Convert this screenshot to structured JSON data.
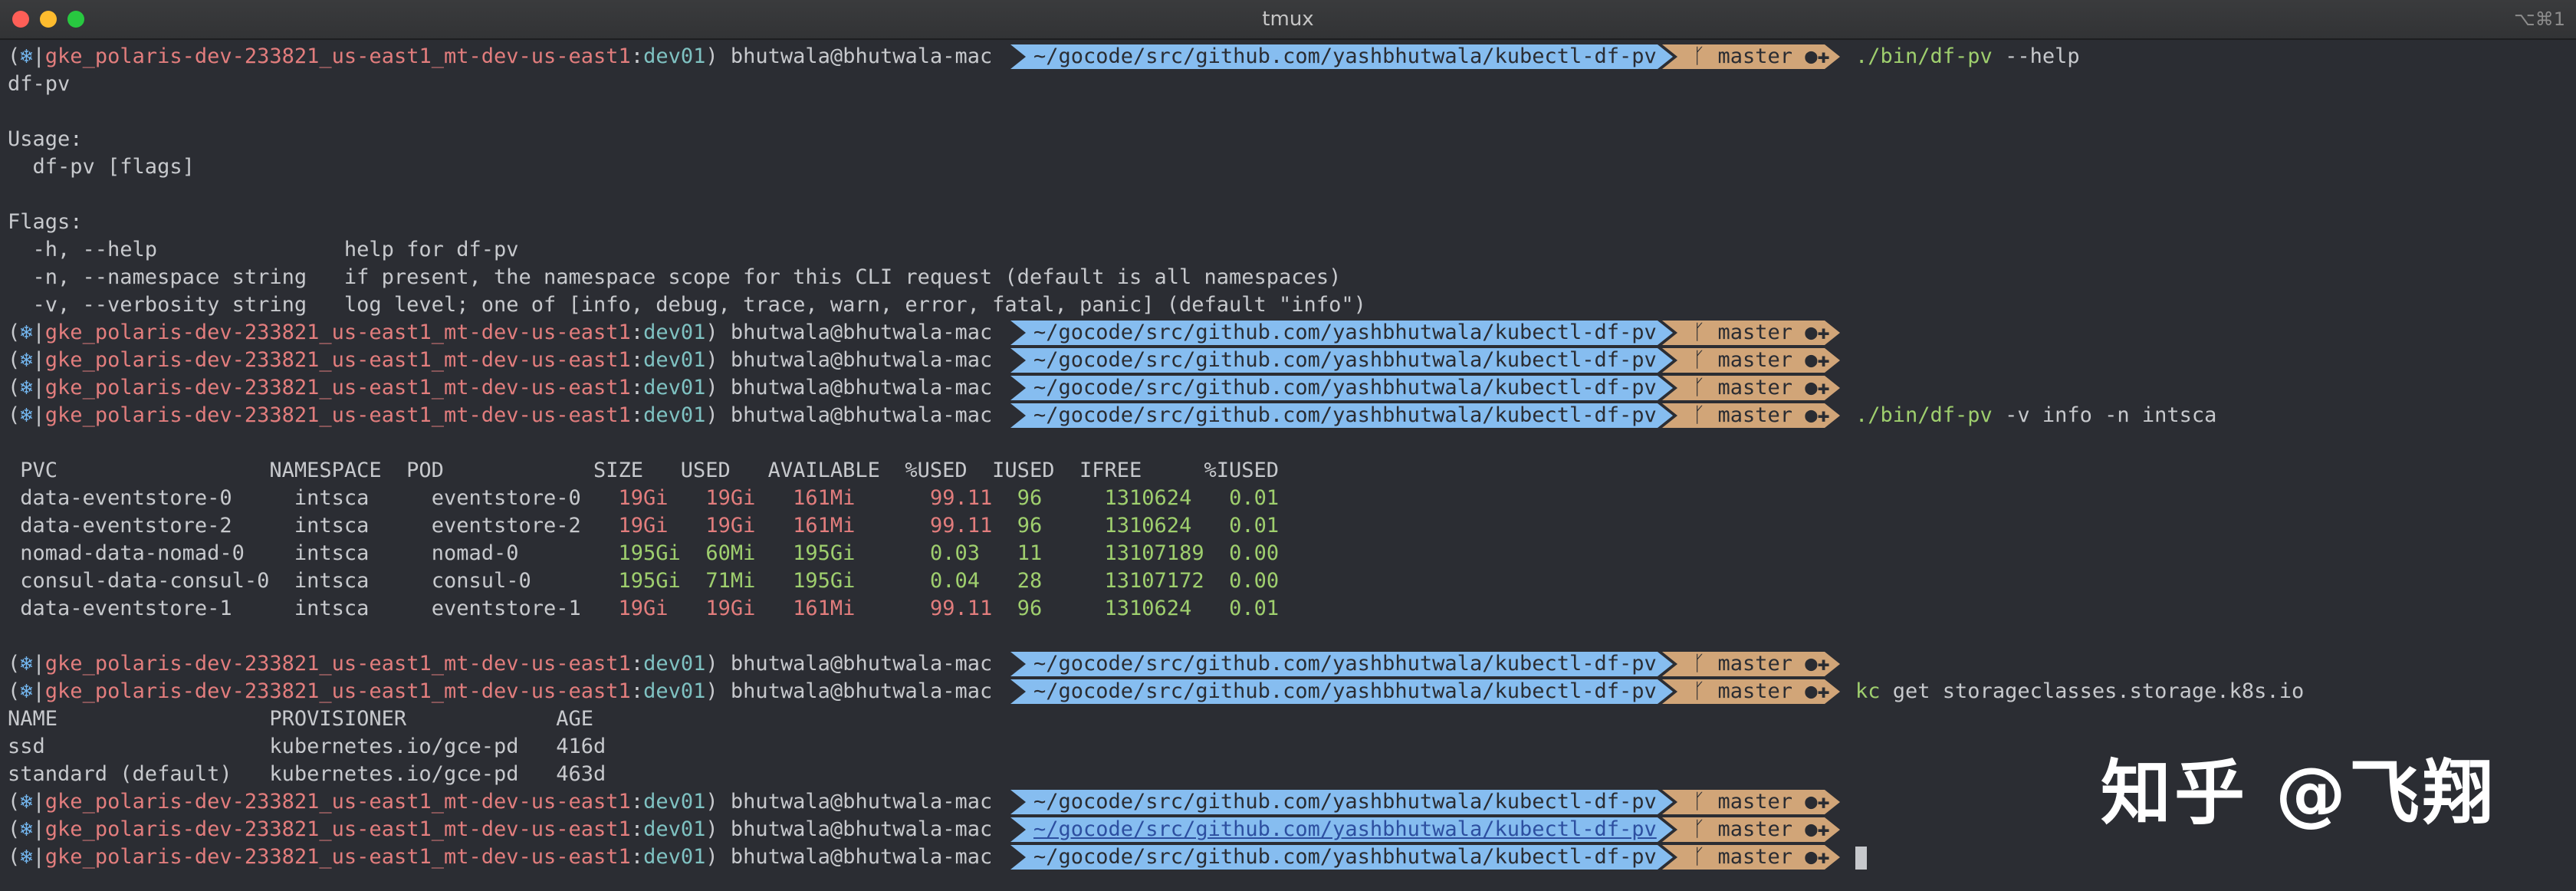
{
  "window": {
    "title": "tmux",
    "shortcut": "⌥⌘1"
  },
  "prompt": {
    "open": "(",
    "k8s_icon": "❄",
    "sep": "|",
    "context": "gke_polaris-dev-233821_us-east1_mt-dev-us-east1",
    "colon": ":",
    "namespace": "dev01",
    "close": ")",
    "user_host": "bhutwala@bhutwala-mac",
    "path": "~/gocode/src/github.com/yashbhutwala/kubectl-df-pv",
    "branch_icon": "ᚴ",
    "branch": "master",
    "git_status": "●✚"
  },
  "commands": {
    "help": {
      "bin": "./bin/df-pv",
      "args": " --help"
    },
    "run": {
      "bin": "./bin/df-pv",
      "args": " -v info -n intsca"
    },
    "kc": {
      "bin": "kc",
      "args": " get storageclasses.storage.k8s.io"
    }
  },
  "help_text": {
    "name": "df-pv",
    "usage_h": "Usage:",
    "usage": "  df-pv [flags]",
    "flags_h": "Flags:",
    "flag1": "  -h, --help               help for df-pv",
    "flag2": "  -n, --namespace string   if present, the namespace scope for this CLI request (default is all namespaces)",
    "flag3": "  -v, --verbosity string   log level; one of [info, debug, trace, warn, error, fatal, panic] (default \"info\")"
  },
  "pv_table": {
    "header": " PVC                 NAMESPACE  POD            SIZE   USED   AVAILABLE  %USED  IUSED  IFREE     %IUSED",
    "rows": [
      {
        "pvc": " data-eventstore-0     ",
        "ns": "intsca     ",
        "pod": "eventstore-0   ",
        "size": "19Gi   ",
        "used": "19Gi   ",
        "avail": "161Mi      ",
        "pct": "99.11  ",
        "iused": "96     ",
        "ifree": "1310624   ",
        "ipct": "0.01",
        "level": "red"
      },
      {
        "pvc": " data-eventstore-2     ",
        "ns": "intsca     ",
        "pod": "eventstore-2   ",
        "size": "19Gi   ",
        "used": "19Gi   ",
        "avail": "161Mi      ",
        "pct": "99.11  ",
        "iused": "96     ",
        "ifree": "1310624   ",
        "ipct": "0.01",
        "level": "red"
      },
      {
        "pvc": " nomad-data-nomad-0    ",
        "ns": "intsca     ",
        "pod": "nomad-0        ",
        "size": "195Gi  ",
        "used": "60Mi   ",
        "avail": "195Gi      ",
        "pct": "0.03   ",
        "iused": "11     ",
        "ifree": "13107189  ",
        "ipct": "0.00",
        "level": "green"
      },
      {
        "pvc": " consul-data-consul-0  ",
        "ns": "intsca     ",
        "pod": "consul-0       ",
        "size": "195Gi  ",
        "used": "71Mi   ",
        "avail": "195Gi      ",
        "pct": "0.04   ",
        "iused": "28     ",
        "ifree": "13107172  ",
        "ipct": "0.00",
        "level": "green"
      },
      {
        "pvc": " data-eventstore-1     ",
        "ns": "intsca     ",
        "pod": "eventstore-1   ",
        "size": "19Gi   ",
        "used": "19Gi   ",
        "avail": "161Mi      ",
        "pct": "99.11  ",
        "iused": "96     ",
        "ifree": "1310624   ",
        "ipct": "0.01",
        "level": "red"
      }
    ]
  },
  "sc_table": {
    "header": "NAME                 PROVISIONER            AGE",
    "rows": [
      "ssd                  kubernetes.io/gce-pd   416d",
      "standard (default)   kubernetes.io/gce-pd   463d"
    ]
  },
  "watermark": "知乎 @飞翔"
}
